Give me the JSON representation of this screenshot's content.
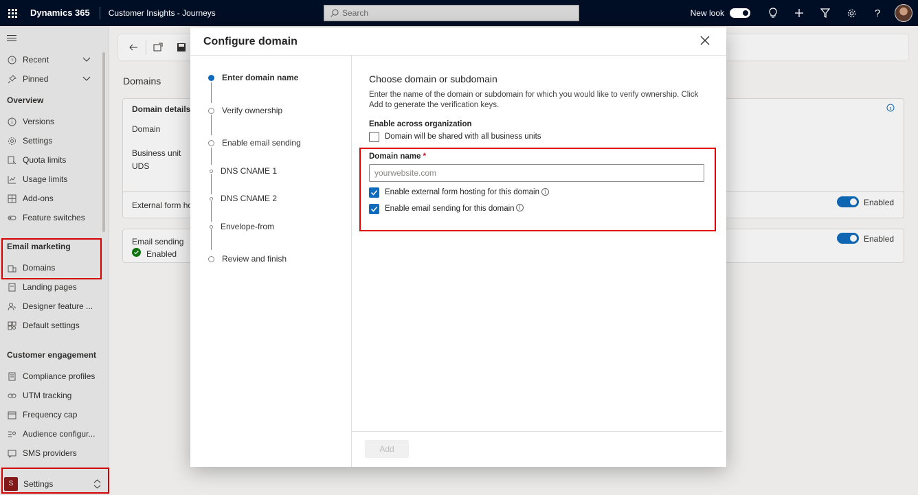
{
  "topbar": {
    "brand": "Dynamics 365",
    "app_name": "Customer Insights - Journeys",
    "search_placeholder": "Search",
    "new_look_label": "New look",
    "icons": [
      "waffle-icon",
      "lightbulb-icon",
      "plus-icon",
      "filter-icon",
      "gear-icon",
      "help-icon",
      "avatar"
    ]
  },
  "sidebar": {
    "recent": "Recent",
    "pinned": "Pinned",
    "overview_header": "Overview",
    "overview_items": [
      {
        "label": "Versions",
        "icon": "info-icon"
      },
      {
        "label": "Settings",
        "icon": "gear-icon"
      },
      {
        "label": "Quota limits",
        "icon": "quota-icon"
      },
      {
        "label": "Usage limits",
        "icon": "chart-icon"
      },
      {
        "label": "Add-ons",
        "icon": "grid-icon"
      },
      {
        "label": "Feature switches",
        "icon": "toggle-icon"
      }
    ],
    "email_header": "Email marketing",
    "email_items": [
      {
        "label": "Domains",
        "icon": "domain-icon"
      },
      {
        "label": "Landing pages",
        "icon": "page-icon"
      },
      {
        "label": "Designer feature ...",
        "icon": "person-icon"
      },
      {
        "label": "Default settings",
        "icon": "settings-grid-icon"
      }
    ],
    "engagement_header": "Customer engagement",
    "engagement_items": [
      {
        "label": "Compliance profiles",
        "icon": "document-icon"
      },
      {
        "label": "UTM tracking",
        "icon": "link-icon"
      },
      {
        "label": "Frequency cap",
        "icon": "calendar-icon"
      },
      {
        "label": "Audience configur...",
        "icon": "list-icon"
      },
      {
        "label": "SMS providers",
        "icon": "sms-icon"
      }
    ],
    "area_badge": "S",
    "area_label": "Settings"
  },
  "background": {
    "page_title": "Domains",
    "domain_details": "Domain details",
    "domain_label": "Domain",
    "business_unit_label": "Business unit",
    "business_unit_value": "UDS",
    "external_form_label": "External form ho",
    "email_sending_label": "Email sending",
    "email_sending_status": "Enabled",
    "toggle1_label": "Enabled",
    "toggle2_label": "Enabled"
  },
  "dialog": {
    "title": "Configure domain",
    "steps": [
      {
        "label": "Enter domain name",
        "state": "active"
      },
      {
        "label": "Verify ownership",
        "state": "pending"
      },
      {
        "label": "Enable email sending",
        "state": "pending"
      },
      {
        "label": "DNS CNAME 1",
        "state": "substep"
      },
      {
        "label": "DNS CNAME 2",
        "state": "substep"
      },
      {
        "label": "Envelope-from",
        "state": "substep"
      },
      {
        "label": "Review and finish",
        "state": "pending"
      }
    ],
    "section_title": "Choose domain or subdomain",
    "description": "Enter the name of the domain or subdomain for which you would like to verify ownership. Click Add to generate the verification keys.",
    "enable_org_label": "Enable across organization",
    "shared_checkbox_label": "Domain will be shared with all business units",
    "shared_checked": false,
    "domain_name_label": "Domain name",
    "required_mark": "*",
    "domain_name_value": "",
    "domain_name_placeholder": "yourwebsite.com",
    "form_hosting_label": "Enable external form hosting for this domain",
    "form_hosting_checked": true,
    "email_sending_label": "Enable email sending for this domain",
    "email_sending_checked": true,
    "add_button": "Add"
  },
  "colors": {
    "accent": "#0f6cbd",
    "topbar": "#000e25",
    "highlight": "#e00000",
    "success": "#107c10"
  }
}
